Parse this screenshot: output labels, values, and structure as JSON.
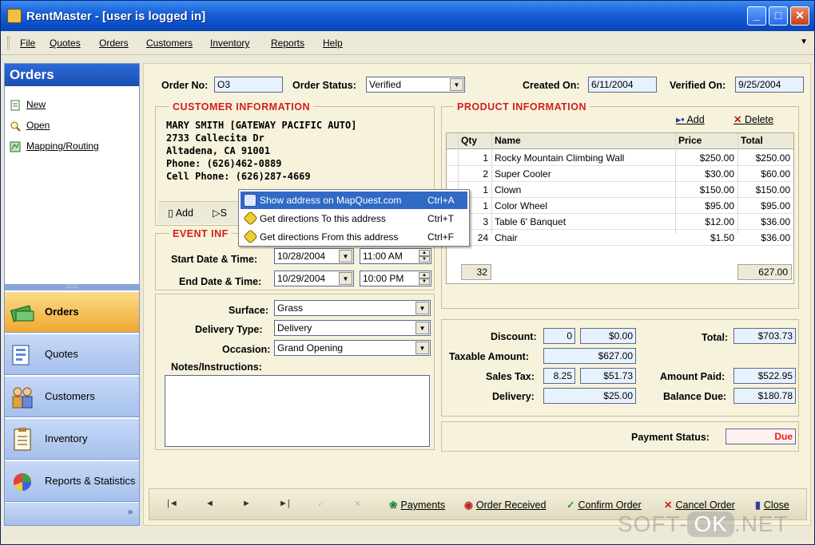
{
  "window": {
    "title": "RentMaster - [user is logged in]"
  },
  "menu": [
    "File",
    "Quotes",
    "Orders",
    "Customers",
    "Inventory",
    "Reports",
    "Help"
  ],
  "left_panel": {
    "header": "Orders",
    "links": [
      "New",
      "Open",
      "Mapping/Routing"
    ],
    "nav": [
      "Orders",
      "Quotes",
      "Customers",
      "Inventory",
      "Reports & Statistics"
    ]
  },
  "order": {
    "number_label": "Order No:",
    "number": "O3",
    "status_label": "Order Status:",
    "status": "Verified",
    "created_label": "Created On:",
    "created": "6/11/2004",
    "verified_label": "Verified On:",
    "verified": "9/25/2004"
  },
  "customer": {
    "title": "CUSTOMER INFORMATION",
    "lines": [
      "MARY SMITH [GATEWAY PACIFIC AUTO]",
      "2733 Callecita Dr",
      "Altadena, CA 91001",
      "Phone: (626)462-0889",
      "Cell Phone: (626)287-4669"
    ],
    "add_label": "Add",
    "second_label": "S"
  },
  "context_menu": [
    {
      "label": "Show address on MapQuest.com",
      "shortcut": "Ctrl+A"
    },
    {
      "label": "Get directions To this address",
      "shortcut": "Ctrl+T"
    },
    {
      "label": "Get directions From this address",
      "shortcut": "Ctrl+F"
    }
  ],
  "event": {
    "title": "EVENT INF",
    "start_label": "Start Date & Time:",
    "start_date": "10/28/2004",
    "start_time": "11:00 AM",
    "end_label": "End Date & Time:",
    "end_date": "10/29/2004",
    "end_time": "10:00 PM",
    "surface_label": "Surface:",
    "surface": "Grass",
    "delivery_label": "Delivery Type:",
    "delivery": "Delivery",
    "occasion_label": "Occasion:",
    "occasion": "Grand Opening",
    "notes_label": "Notes/Instructions:"
  },
  "product": {
    "title": "PRODUCT INFORMATION",
    "add_label": "Add",
    "delete_label": "Delete",
    "columns": [
      "Qty",
      "Name",
      "Price",
      "Total"
    ],
    "rows": [
      {
        "qty": "1",
        "name": "Rocky Mountain Climbing Wall",
        "price": "$250.00",
        "total": "$250.00"
      },
      {
        "qty": "2",
        "name": "Super Cooler",
        "price": "$30.00",
        "total": "$60.00"
      },
      {
        "qty": "1",
        "name": "Clown",
        "price": "$150.00",
        "total": "$150.00"
      },
      {
        "qty": "1",
        "name": "Color Wheel",
        "price": "$95.00",
        "total": "$95.00"
      },
      {
        "qty": "3",
        "name": "Table 6' Banquet",
        "price": "$12.00",
        "total": "$36.00"
      },
      {
        "qty": "24",
        "name": "Chair",
        "price": "$1.50",
        "total": "$36.00"
      }
    ],
    "footer_qty": "32",
    "footer_total": "627.00"
  },
  "totals": {
    "discount_label": "Discount:",
    "discount_pct": "0",
    "discount": "$0.00",
    "taxable_label": "Taxable Amount:",
    "taxable": "$627.00",
    "tax_label": "Sales Tax:",
    "tax_rate": "8.25",
    "tax": "$51.73",
    "delivery_label": "Delivery:",
    "delivery": "$25.00",
    "total_label": "Total:",
    "total": "$703.73",
    "paid_label": "Amount Paid:",
    "paid": "$522.95",
    "balance_label": "Balance Due:",
    "balance": "$180.78",
    "payment_status_label": "Payment Status:",
    "payment_status": "Due"
  },
  "bottom": {
    "nav": [
      "|◄",
      "◄",
      "►",
      "►|",
      "✓",
      "✕"
    ],
    "payments": "Payments",
    "received": "Order Received",
    "confirm": "Confirm Order",
    "cancel": "Cancel Order",
    "close": "Close"
  },
  "watermark": {
    "left": "SOFT-",
    "ok": "OK",
    "right": ".NET"
  },
  "colors": {
    "title_blue": "#1a62d8",
    "accent_red": "#d02020",
    "field_blue": "#e8f2ff",
    "nav_active": "#f0a830"
  }
}
